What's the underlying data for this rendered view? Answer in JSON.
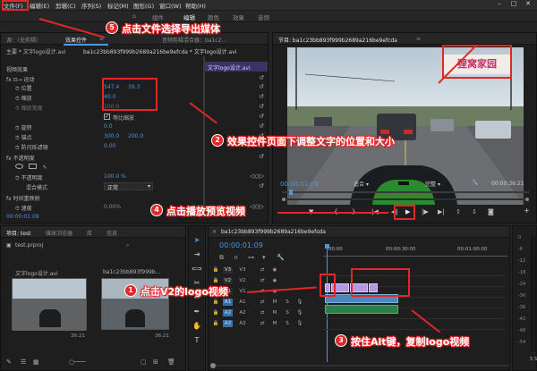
{
  "menu": [
    "文件(F)",
    "编辑(E)",
    "剪辑(C)",
    "序列(S)",
    "标记(M)",
    "图形(G)",
    "窗口(W)",
    "帮助(H)"
  ],
  "workspaces": [
    "组件",
    "编辑",
    "颜色",
    "效果",
    "音频"
  ],
  "source_tab": "源：（无剪辑）",
  "effect_tab": "效果控件",
  "effect_tab_menu": "≡",
  "audio_tab": "音频剪辑混合器：ba1c2…",
  "master_label": "主要 * 文字logo设计.avi",
  "master_seq": "ba1c23bb893f999b2689a216be9efcda * 文字logo设计.avi",
  "mini_clip": "文字logo设计.avi",
  "video_effects": "视频效果",
  "motion": "运动",
  "pos_label": "位置",
  "pos_x": "547.4",
  "pos_y": "39.3",
  "scale_label": "缩放",
  "scale_val": "40.0",
  "scale_w_label": "缩放宽度",
  "scale_w_val": "100.0",
  "uniform_label": "等比缩放",
  "rotate_label": "旋转",
  "rotate_val": "0.0",
  "anchor_label": "锚点",
  "anchor_x": "300.0",
  "anchor_y": "200.0",
  "flicker_label": "防闪烁滤镜",
  "flicker_val": "0.00",
  "opacity_label": "不透明度",
  "opacity_sub": "不透明度",
  "opacity_val": "100.0 %",
  "blend_label": "混合模式",
  "blend_val": "正常",
  "time_remap": "时间重映射",
  "speed_label": "速度",
  "speed_val": "0.00%",
  "ec_timecode": "00:00:01:09",
  "program_title": "节目: ba1c23bb893f999b2689a216be9efcda",
  "program_menu": "≡",
  "watermark": "狸窝家园",
  "prog_tc": "00:00:01:09",
  "fit": "适合",
  "quality": "完整",
  "prog_dur": "00:00:36:21",
  "project_tab": "项目: test",
  "media_tab": "媒体浏览器",
  "lib_tab": "库",
  "info_tab": "信息",
  "proj_file": "test.prproj",
  "clip1_name": "文字logo设计.avi",
  "clip1_dur": "36:21",
  "clip2_name": "ba1c23bb893f999b...",
  "clip2_dur": "36:21",
  "seq_tab": "ba1c23bb893f999b2689a216be9efcda",
  "seq_menu": "≡",
  "seq_tc": "00:00:01:09",
  "ruler": [
    ":00:00",
    "00:00:30:00",
    "00:01:00:00"
  ],
  "tracks": [
    {
      "name": "V3",
      "kind": "video"
    },
    {
      "name": "V2",
      "kind": "video"
    },
    {
      "name": "V1",
      "kind": "video"
    },
    {
      "name": "A1",
      "kind": "audio"
    },
    {
      "name": "A2",
      "kind": "audio"
    },
    {
      "name": "A3",
      "kind": "audio"
    }
  ],
  "meter_ticks": [
    "0",
    "-6",
    "-12",
    "-18",
    "-24",
    "-30",
    "-36",
    "-42",
    "-48",
    "-54"
  ],
  "meter_units": [
    "S",
    "S"
  ],
  "callouts": [
    {
      "n": "1",
      "text": "点击V2的logo视频"
    },
    {
      "n": "2",
      "text": "效果控件页面下调整文字的位置和大小"
    },
    {
      "n": "3",
      "text": "按住Alt键，复制logo视频"
    },
    {
      "n": "4",
      "text": "点击播放预览视频"
    },
    {
      "n": "5",
      "text": "点击文件选择导出媒体"
    }
  ],
  "colors": {
    "annotation": "#e32626",
    "accent": "#4d93e6",
    "logo_clip": "#b896e6",
    "video_clip": "#4f86b8"
  }
}
